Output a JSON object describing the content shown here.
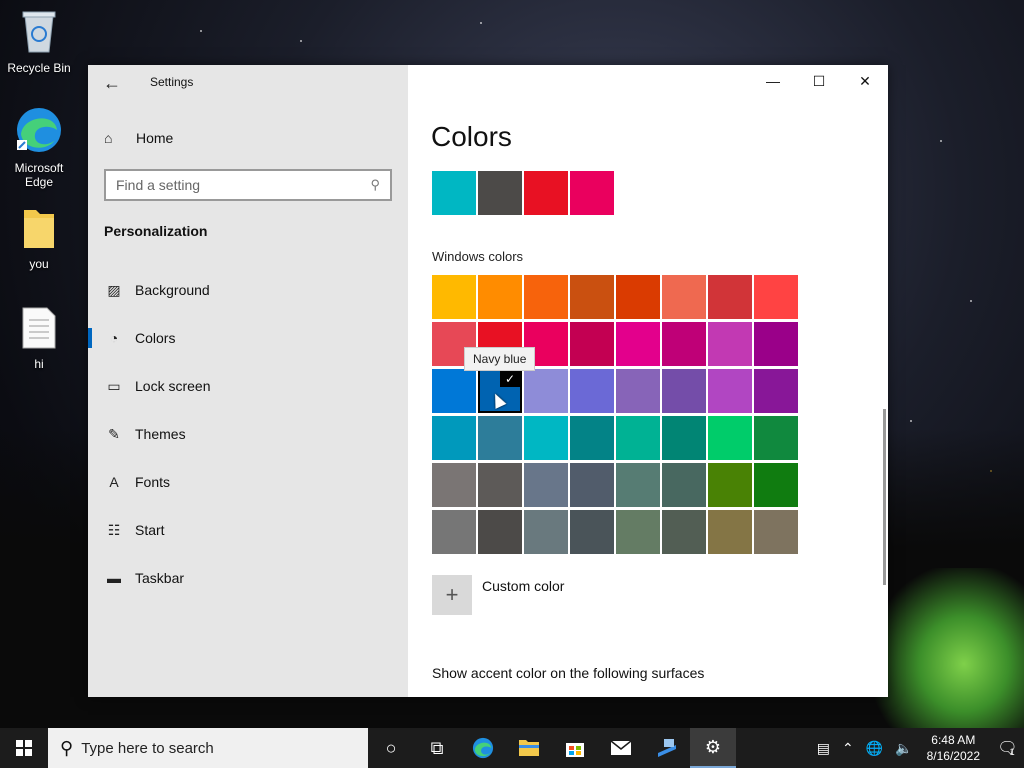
{
  "desktop": {
    "icons": [
      {
        "label": "Recycle Bin",
        "icon": "recycle-bin-icon"
      },
      {
        "label": "Microsoft Edge",
        "icon": "edge-icon"
      },
      {
        "label": "you",
        "icon": "folder-icon"
      },
      {
        "label": "hi",
        "icon": "text-file-icon"
      }
    ]
  },
  "window": {
    "app_title": "Settings",
    "controls": {
      "minimize": "—",
      "maximize": "☐",
      "close": "✕"
    }
  },
  "sidebar": {
    "home_label": "Home",
    "search_placeholder": "Find a setting",
    "section_title": "Personalization",
    "items": [
      {
        "label": "Background",
        "icon": "image-icon",
        "glyph": "🖼"
      },
      {
        "label": "Colors",
        "icon": "palette-icon",
        "glyph": "🎨",
        "active": true
      },
      {
        "label": "Lock screen",
        "icon": "lock-screen-icon",
        "glyph": "▭"
      },
      {
        "label": "Themes",
        "icon": "themes-icon",
        "glyph": "✎"
      },
      {
        "label": "Fonts",
        "icon": "fonts-icon",
        "glyph": "A"
      },
      {
        "label": "Start",
        "icon": "start-icon",
        "glyph": "☷"
      },
      {
        "label": "Taskbar",
        "icon": "taskbar-icon",
        "glyph": "▬"
      }
    ]
  },
  "main": {
    "page_title": "Colors",
    "recent_colors": [
      "#00b7c3",
      "#4c4a48",
      "#e81123",
      "#ea005e"
    ],
    "windows_colors_title": "Windows colors",
    "windows_colors": [
      [
        "#ffb900",
        "#ff8c00",
        "#f7630c",
        "#ca5010",
        "#da3b01",
        "#ef6950",
        "#d13438",
        "#ff4343"
      ],
      [
        "#e74856",
        "#e81123",
        "#ea005e",
        "#c30052",
        "#e3008c",
        "#bf0077",
        "#c239b3",
        "#9a0089"
      ],
      [
        "#0078d7",
        "#0063b1",
        "#8e8cd8",
        "#6b69d6",
        "#8764b8",
        "#744da9",
        "#b146c2",
        "#881798"
      ],
      [
        "#0099bc",
        "#2d7d9a",
        "#00b7c3",
        "#038387",
        "#00b294",
        "#018574",
        "#00cc6a",
        "#10893e"
      ],
      [
        "#7a7574",
        "#5d5a58",
        "#68768a",
        "#515c6b",
        "#567c73",
        "#486860",
        "#498205",
        "#107c10"
      ],
      [
        "#767676",
        "#4c4a48",
        "#69797e",
        "#4a5459",
        "#647c64",
        "#525e54",
        "#847545",
        "#7e735f"
      ]
    ],
    "selected_color": {
      "row": 2,
      "col": 1
    },
    "tooltip": "Navy blue",
    "custom_color_label": "Custom color",
    "custom_color_glyph": "+",
    "surfaces_label": "Show accent color on the following surfaces"
  },
  "taskbar": {
    "search_placeholder": "Type here to search",
    "time": "6:48 AM",
    "date": "8/16/2022",
    "notification_count": "1"
  }
}
